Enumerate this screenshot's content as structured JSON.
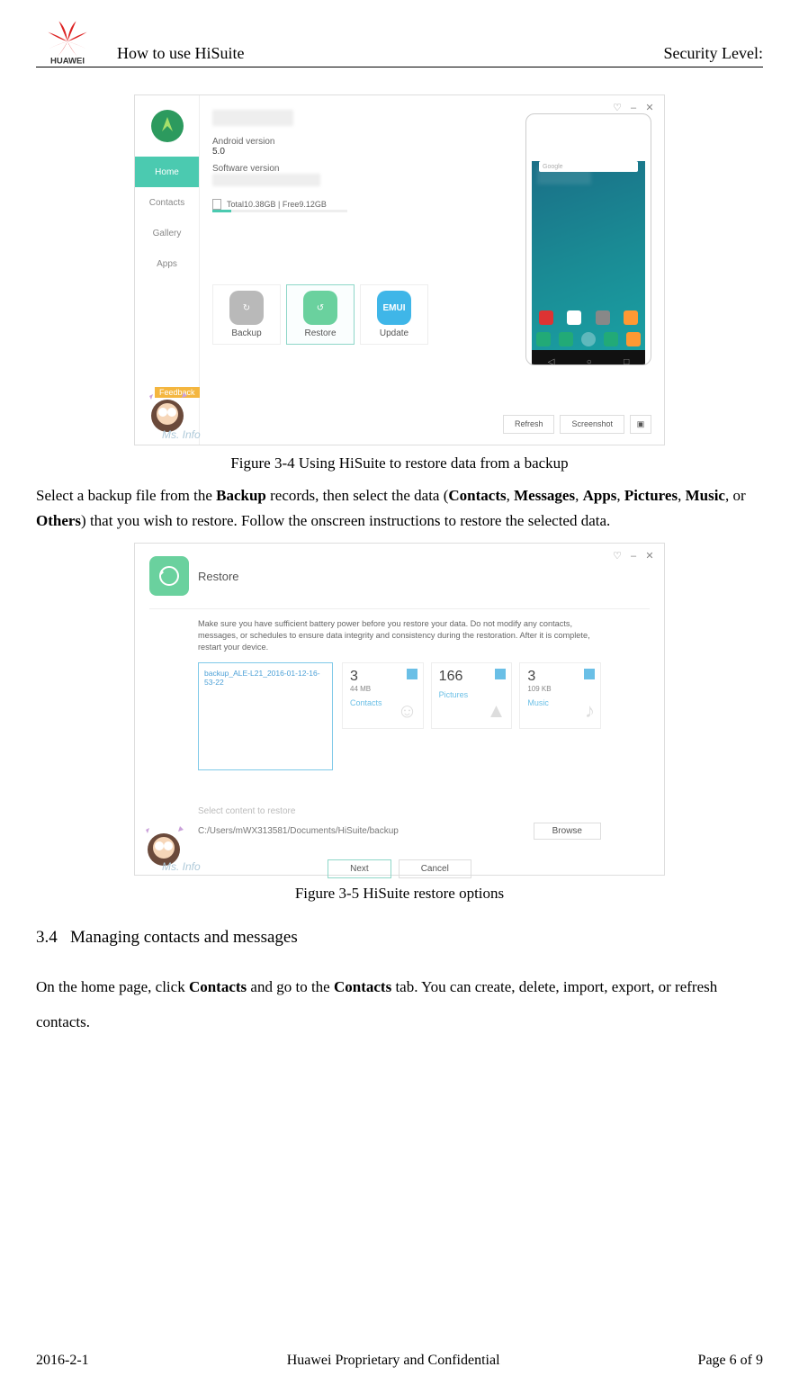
{
  "header": {
    "title": "How to use HiSuite",
    "security": "Security Level:"
  },
  "logo_text": "HUAWEI",
  "fig1": {
    "sidebar": {
      "home": "Home",
      "contacts": "Contacts",
      "gallery": "Gallery",
      "apps": "Apps"
    },
    "android_version_label": "Android version",
    "android_version_value": "5.0",
    "software_version_label": "Software version",
    "storage_text": "Total10.38GB | Free9.12GB",
    "actions": {
      "backup": "Backup",
      "restore": "Restore",
      "update": "Update",
      "emui": "EMUI"
    },
    "phone_buttons": {
      "refresh": "Refresh",
      "screenshot": "Screenshot"
    },
    "google_placeholder": "Google",
    "feedback": "Feedback",
    "msinfo": "Ms. Info"
  },
  "caption1": "Figure 3-4 Using HiSuite to restore data from a backup",
  "para1": {
    "t1": "Select a backup file from the ",
    "b1": "Backup",
    "t2": " records, then select the data (",
    "b2": "Contacts",
    "t3": ", ",
    "b3": "Messages",
    "t4": ", ",
    "b4": "Apps",
    "t5": ", ",
    "b5": "Pictures",
    "t6": ", ",
    "b6": "Music",
    "t7": ", or ",
    "b7": "Others",
    "t8": ") that you wish to restore. Follow the onscreen instructions to restore the selected data."
  },
  "fig2": {
    "title": "Restore",
    "warning": "Make sure you have sufficient battery power before you restore your data. Do not modify any contacts, messages, or schedules to ensure data integrity and consistency during the restoration. After it is complete, restart your device.",
    "backup_file": "backup_ALE-L21_2016-01-12-16-53-22",
    "cards": {
      "contacts": {
        "num": "3",
        "sub": "44 MB",
        "name": "Contacts"
      },
      "pictures": {
        "num": "166",
        "sub": "",
        "name": "Pictures"
      },
      "music": {
        "num": "3",
        "sub": "109 KB",
        "name": "Music"
      }
    },
    "select_label": "Select content to restore",
    "path": "C:/Users/mWX313581/Documents/HiSuite/backup",
    "browse": "Browse",
    "next": "Next",
    "cancel": "Cancel",
    "msinfo": "Ms. Info"
  },
  "caption2": "Figure 3-5 HiSuite restore options",
  "section": {
    "num": "3.4",
    "title": "Managing contacts and messages"
  },
  "para2": {
    "t1": "On the home page, click ",
    "b1": "Contacts",
    "t2": " and go to the ",
    "b2": "Contacts",
    "t3": " tab. You can create, delete, import, export, or refresh contacts."
  },
  "footer": {
    "date": "2016-2-1",
    "center": "Huawei Proprietary and Confidential",
    "page": "Page 6 of 9"
  }
}
